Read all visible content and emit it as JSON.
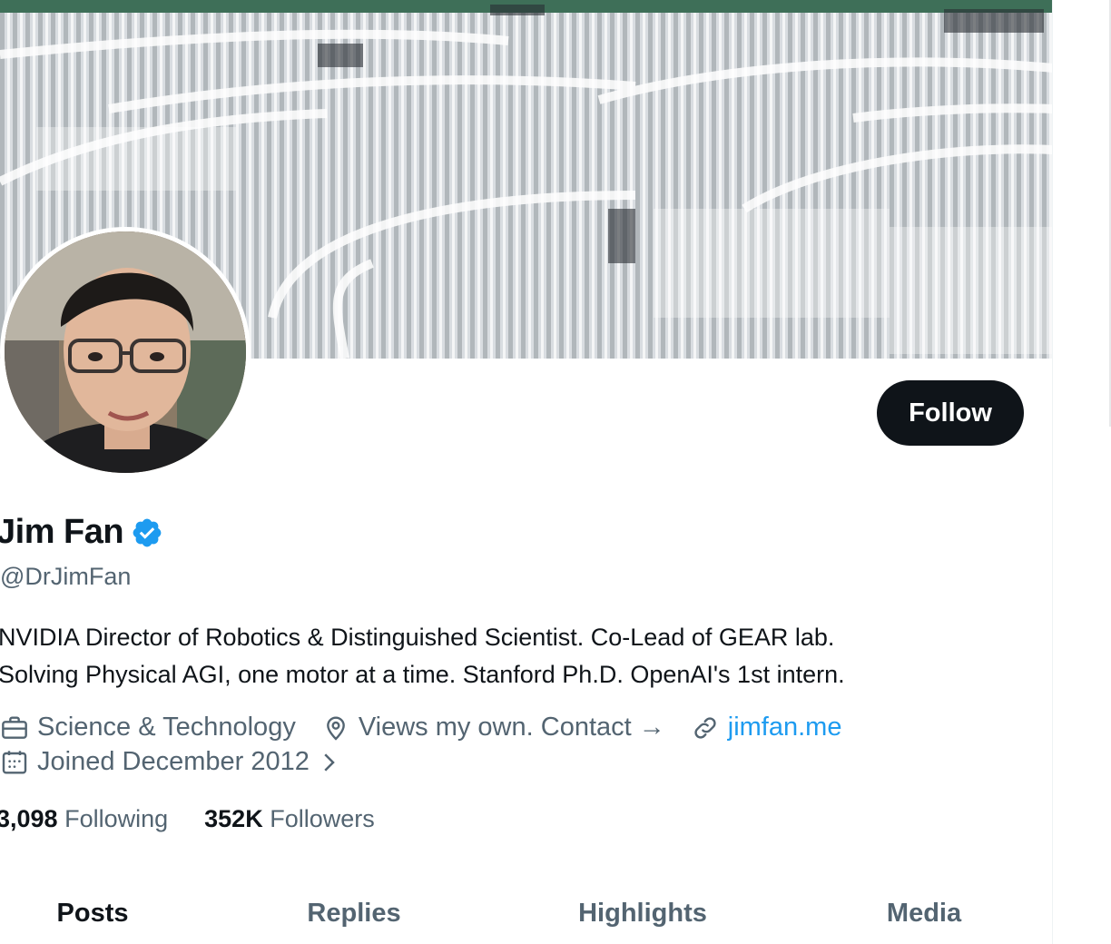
{
  "profile": {
    "display_name": "Jim Fan",
    "handle": "@DrJimFan",
    "bio_line1": "NVIDIA Director of Robotics & Distinguished Scientist. Co-Lead of GEAR lab.",
    "bio_line2": "Solving Physical AGI, one motor at a time. Stanford Ph.D. OpenAI's 1st intern.",
    "category": "Science & Technology",
    "location": "Views my own. Contact →",
    "website": "jimfan.me",
    "joined": "Joined December 2012",
    "following_count": "3,098",
    "following_label": "Following",
    "followers_count": "352K",
    "followers_label": "Followers",
    "follow_label": "Follow"
  },
  "tabs": [
    {
      "label": "Posts"
    },
    {
      "label": "Replies"
    },
    {
      "label": "Highlights"
    },
    {
      "label": "Media"
    }
  ],
  "colors": {
    "accent": "#1d9bf0",
    "text": "#0f1419",
    "secondary": "#536471",
    "button": "#0f1419"
  },
  "icons": {
    "verified": "verified-badge-icon",
    "category": "briefcase-icon",
    "location": "location-pin-icon",
    "website": "link-icon",
    "joined": "calendar-icon",
    "joined_more": "chevron-right-icon"
  }
}
